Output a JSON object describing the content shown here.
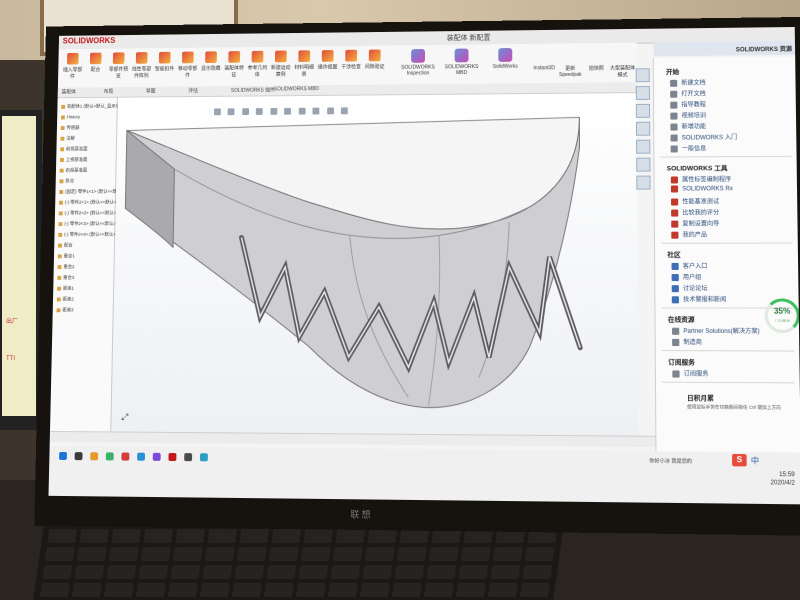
{
  "window": {
    "title": "装配体 新配置",
    "app_logo": "SOLIDWORKS"
  },
  "ribbon": {
    "buttons": [
      "插入零部件",
      "配合",
      "零部件预览",
      "线性零部件阵列",
      "智能扣件",
      "移动零部件",
      "显示隐藏",
      "装配体特征",
      "参考几何体",
      "新建运动算例",
      "材料明细表",
      "爆炸视图",
      "干涉检查",
      "间隙验证"
    ],
    "big_buttons": [
      "Instant3D",
      "更新Speedpak",
      "拍快照",
      "大型装配体模式"
    ],
    "plugins": [
      "SOLIDWORKS Inspection",
      "SOLIDWORKS MBD",
      "SolidWorks"
    ]
  },
  "tabs": [
    "装配体",
    "布局",
    "草图",
    "评估",
    "SOLIDWORKS 插件",
    "SOLIDWORKS MBD"
  ],
  "feature_tree": {
    "rows": [
      "装配体1 (默认<默认_显示状态-1>)",
      "History",
      "传感器",
      "注解",
      "前视基准面",
      "上视基准面",
      "右视基准面",
      "原点",
      "(固定) 零件1<1> (默认<<默认>",
      "(-) 零件2<1> (默认<<默认>",
      "(-) 零件2<2> (默认<<默认>",
      "(-) 零件2<3> (默认<<默认>",
      "(-) 零件2<4> (默认<<默认>",
      "配合",
      "重合1",
      "重合2",
      "重合3",
      "距离1",
      "距离2",
      "距离3"
    ]
  },
  "taskpane": {
    "header": "SOLIDWORKS 资源",
    "start_heading": "开始",
    "start_items": [
      "新建文档",
      "打开文档",
      "指导教程",
      "视频培训",
      "新增功能",
      "SOLIDWORKS 入门",
      "一般信息"
    ],
    "tools_heading": "SOLIDWORKS 工具",
    "tools_items": [
      "属性标签编制程序",
      "SOLIDWORKS Rx",
      "性能基准测试",
      "比较我的评分",
      "复制设置向导",
      "我的产品"
    ],
    "community_heading": "社区",
    "community_items": [
      "客户入口",
      "用户组",
      "讨论论坛",
      "技术警报和新闻"
    ],
    "online_heading": "在线资源",
    "online_items": [
      "Partner Solutions(解决方案)",
      "制造商"
    ],
    "subscription_heading": "订阅服务",
    "subscription_items": [
      "订阅服务"
    ],
    "tips_heading": "日积月累",
    "tips_text": "使用鼠标手势在切换期间按住 Ctrl 键加上方向",
    "gauge_percent": "35%",
    "gauge_rate": "↑ 0.4K/s",
    "gauge_value": 35
  },
  "taskbar": {
    "ime_logo": "S",
    "ime_lang": "中",
    "notify_text": "你好小冰 我是您的",
    "time": "15:59",
    "date": "2020/4/2"
  },
  "environment": {
    "monitor_brand": "联想",
    "left_screen_texts": [
      "出厂",
      "TTI"
    ]
  },
  "colors": {
    "sw_red": "#c4161c",
    "link_blue": "#2a4a7a",
    "gauge_green": "#3fbf5f"
  }
}
